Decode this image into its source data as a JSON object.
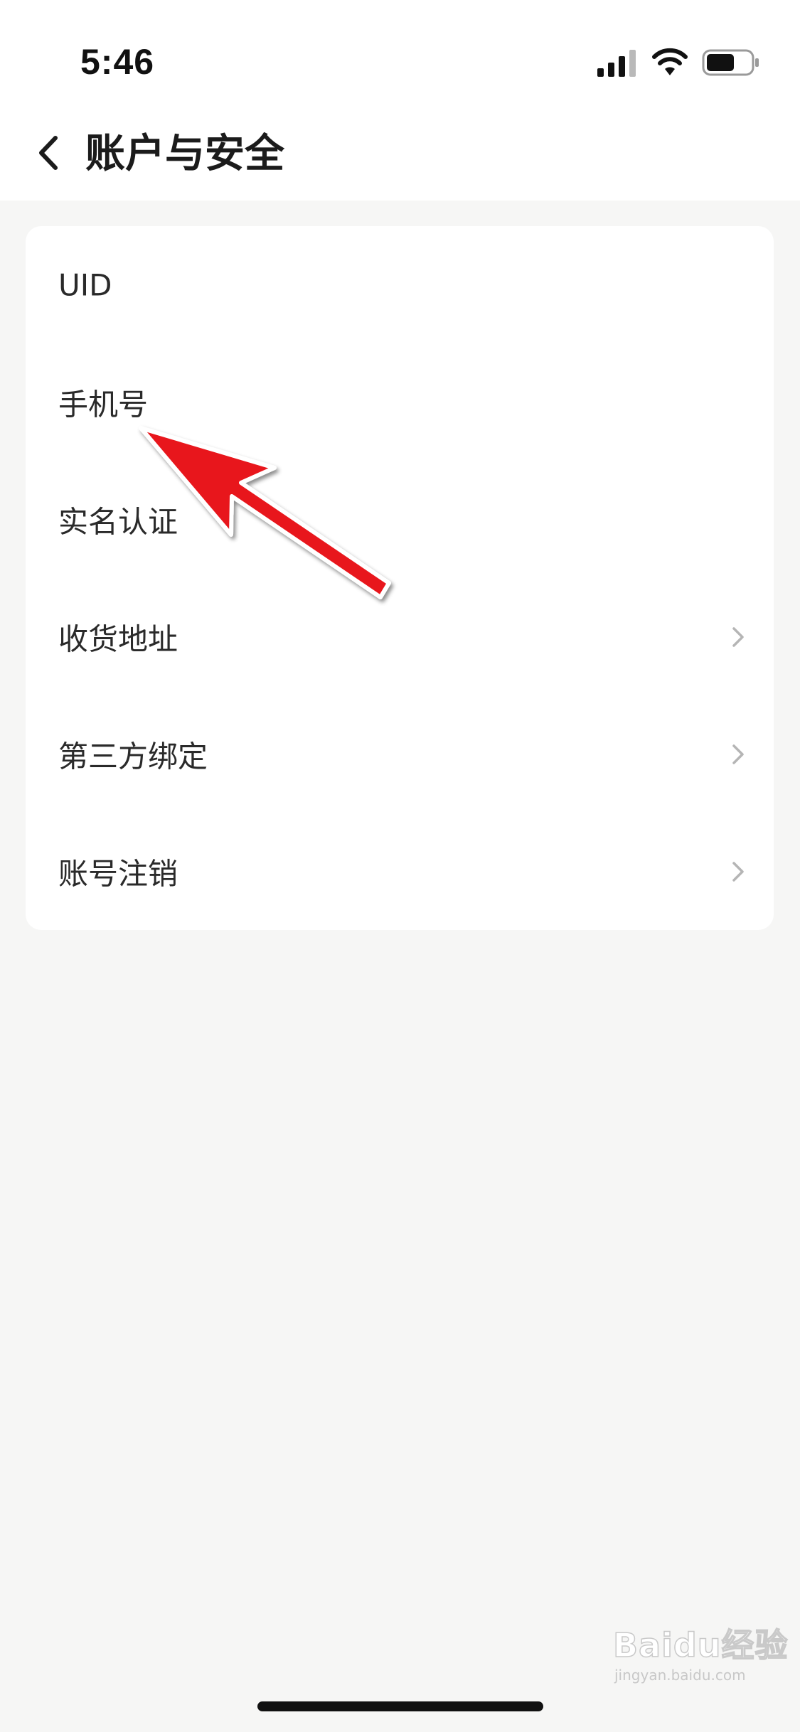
{
  "status_bar": {
    "time": "5:46",
    "icons": [
      "signal-icon",
      "wifi-icon",
      "battery-icon"
    ]
  },
  "nav": {
    "title": "账户与安全",
    "back_icon": "chevron-left-icon"
  },
  "rows": [
    {
      "label": "UID",
      "value": "",
      "value_blurred": true,
      "chevron": false
    },
    {
      "label": "手机号",
      "value": "",
      "value_blurred": true,
      "chevron": false
    },
    {
      "label": "实名认证",
      "value": "",
      "value_blurred": true,
      "chevron": false
    },
    {
      "label": "收货地址",
      "chevron": true
    },
    {
      "label": "第三方绑定",
      "chevron": true
    },
    {
      "label": "账号注销",
      "chevron": true
    }
  ],
  "annotation": {
    "type": "arrow",
    "color": "#e8141b",
    "points_to": "手机号"
  },
  "watermark": {
    "main": "Baidu经验",
    "sub": "jingyan.baidu.com"
  },
  "colors": {
    "background": "#f6f6f5",
    "card": "#ffffff",
    "text": "#2a2a2a",
    "chevron": "#b5b5b5",
    "arrow": "#e8141b"
  }
}
